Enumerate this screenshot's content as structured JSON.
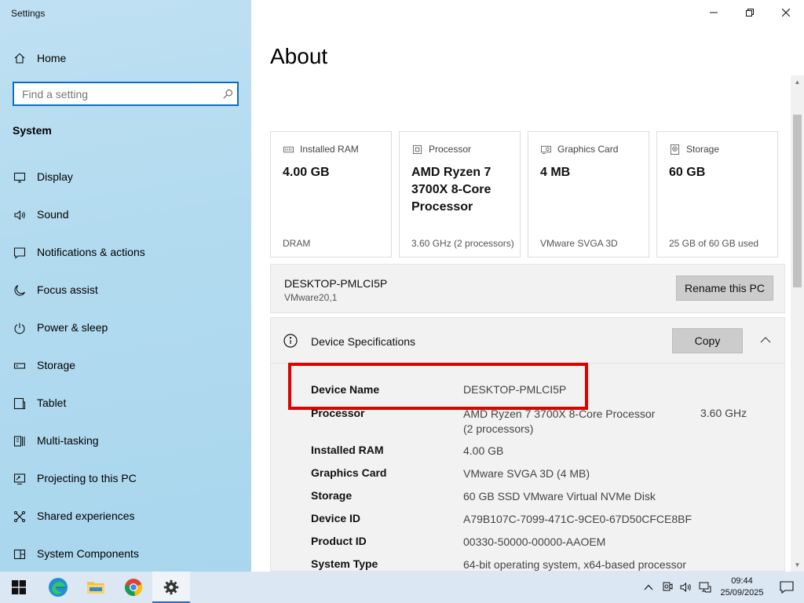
{
  "app": {
    "title": "Settings"
  },
  "sidebar": {
    "home_label": "Home",
    "search": {
      "placeholder": "Find a setting"
    },
    "section_label": "System",
    "items": [
      {
        "label": "Display",
        "icon": "display-icon"
      },
      {
        "label": "Sound",
        "icon": "sound-icon"
      },
      {
        "label": "Notifications & actions",
        "icon": "notifications-icon"
      },
      {
        "label": "Focus assist",
        "icon": "moon-icon"
      },
      {
        "label": "Power & sleep",
        "icon": "power-icon"
      },
      {
        "label": "Storage",
        "icon": "storage-icon"
      },
      {
        "label": "Tablet",
        "icon": "tablet-icon"
      },
      {
        "label": "Multi-tasking",
        "icon": "multitasking-icon"
      },
      {
        "label": "Projecting to this PC",
        "icon": "projecting-icon"
      },
      {
        "label": "Shared experiences",
        "icon": "shared-experiences-icon"
      },
      {
        "label": "System Components",
        "icon": "components-icon"
      }
    ]
  },
  "main": {
    "title": "About",
    "cards": [
      {
        "label": "Installed RAM",
        "value": "4.00 GB",
        "footer": "DRAM",
        "icon": "ram-icon"
      },
      {
        "label": "Processor",
        "value": "AMD Ryzen 7 3700X 8-Core Processor",
        "footer": "3.60 GHz (2 processors)",
        "icon": "processor-icon"
      },
      {
        "label": "Graphics Card",
        "value": "4 MB",
        "footer": "VMware SVGA 3D",
        "icon": "graphics-card-icon"
      },
      {
        "label": "Storage",
        "value": "60 GB",
        "footer": "25 GB of 60 GB used",
        "icon": "storage-drive-icon"
      }
    ],
    "pc": {
      "name": "DESKTOP-PMLCI5P",
      "model": "VMware20,1",
      "rename_label": "Rename this PC"
    },
    "specs": {
      "title": "Device Specifications",
      "copy_label": "Copy",
      "highlight": {
        "label": "Device Name",
        "value": "DESKTOP-PMLCI5P"
      },
      "rows": [
        {
          "label": "Processor",
          "value": "AMD Ryzen 7 3700X 8-Core Processor",
          "value2": "(2 processors)",
          "extra": "3.60 GHz"
        },
        {
          "label": "Installed RAM",
          "value": "4.00 GB"
        },
        {
          "label": "Graphics Card",
          "value": "VMware SVGA 3D (4 MB)"
        },
        {
          "label": "Storage",
          "value": "60 GB SSD VMware Virtual NVMe Disk"
        },
        {
          "label": "Device ID",
          "value": "A79B107C-7099-471C-9CE0-67D50CFCE8BF"
        },
        {
          "label": "Product ID",
          "value": "00330-50000-00000-AAOEM"
        },
        {
          "label": "System Type",
          "value": "64-bit operating system, x64-based processor"
        }
      ]
    }
  },
  "taskbar": {
    "apps": [
      "start",
      "edge",
      "file-explorer",
      "chrome",
      "settings"
    ],
    "clock": {
      "time": "09:44",
      "date": "25/09/2025"
    }
  },
  "colors": {
    "accent": "#0a6fc2",
    "highlight_border": "#e00000",
    "sidebar_bg": "#b3dbef",
    "taskbar_bg": "#dbe7f3"
  }
}
